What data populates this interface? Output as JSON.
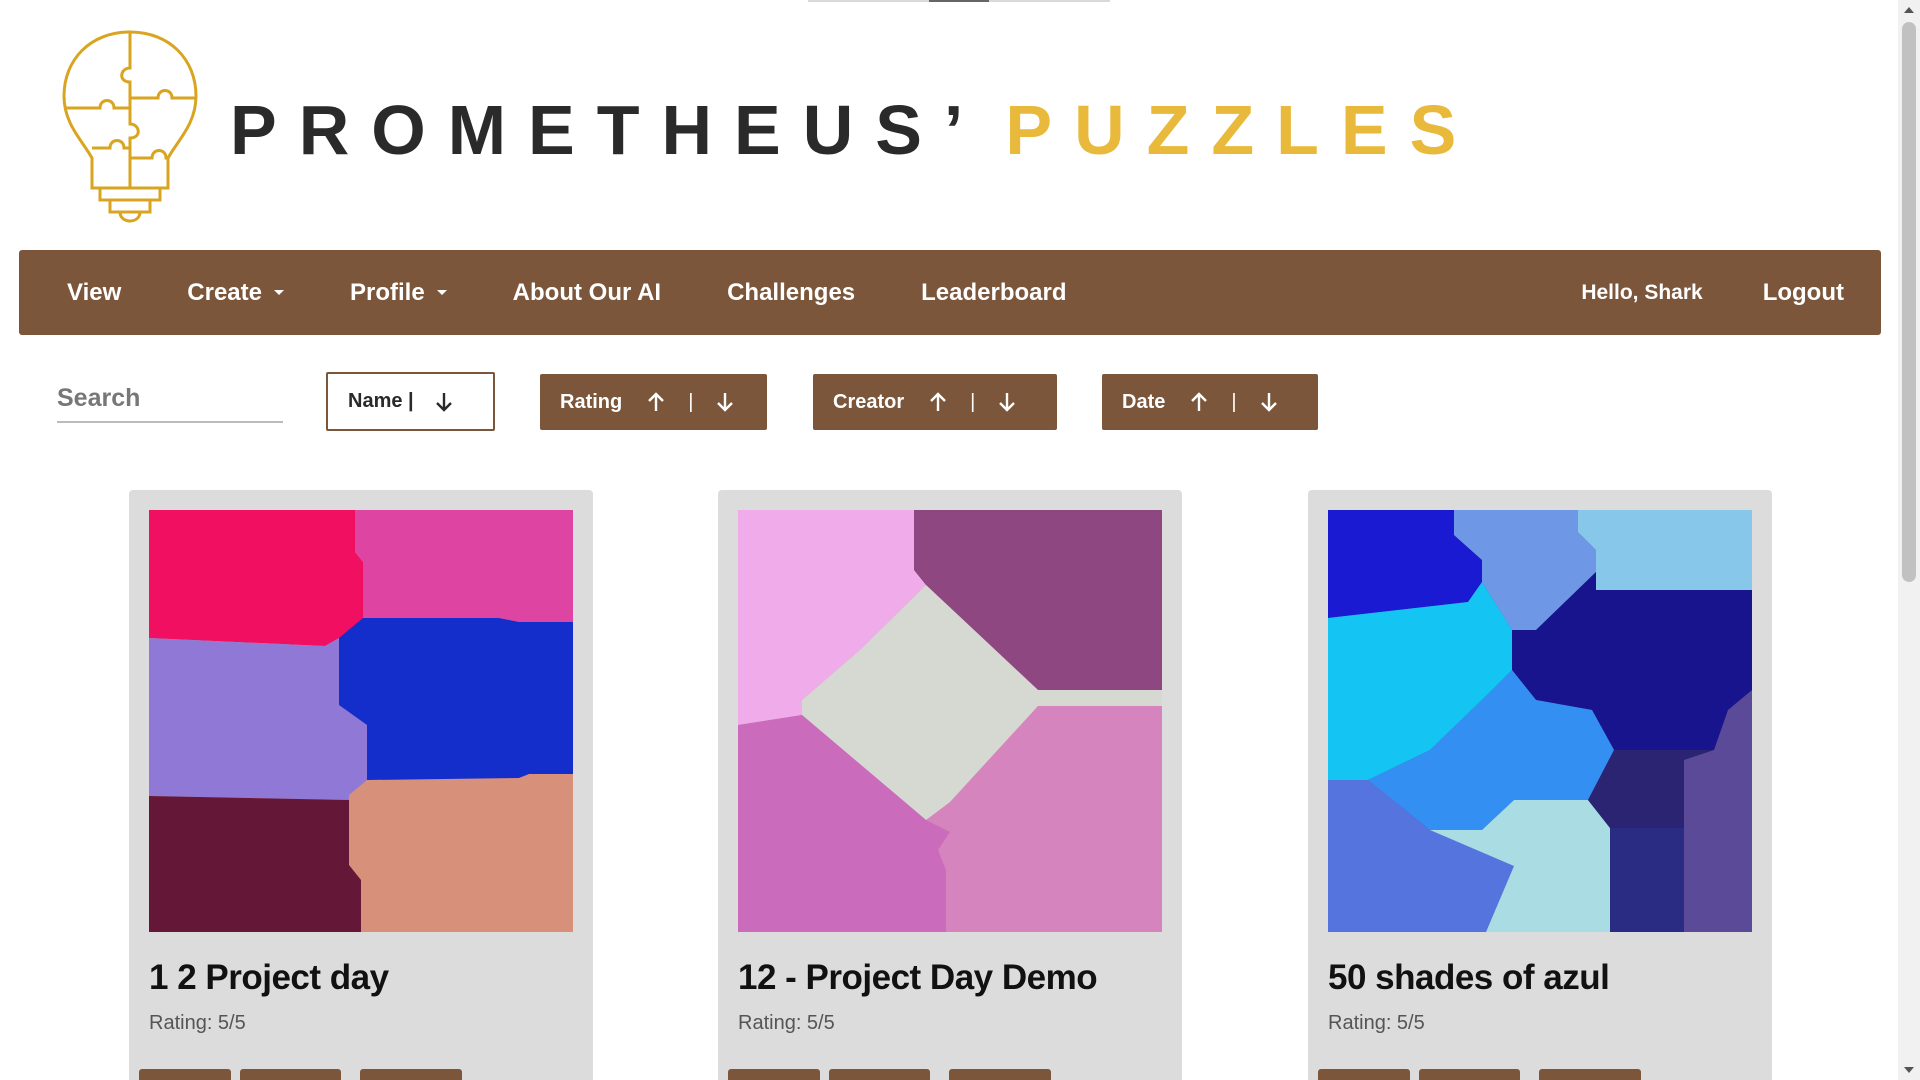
{
  "brand": {
    "word1": "PROMETHEUS’",
    "word2": "PUZZLES",
    "color_dark": "#2a2a2a",
    "color_gold": "#e8b93a"
  },
  "nav": {
    "items": [
      {
        "label": "View",
        "dropdown": false
      },
      {
        "label": "Create",
        "dropdown": true
      },
      {
        "label": "Profile",
        "dropdown": true
      },
      {
        "label": "About Our AI",
        "dropdown": false
      },
      {
        "label": "Challenges",
        "dropdown": false
      },
      {
        "label": "Leaderboard",
        "dropdown": false
      }
    ],
    "greeting": "Hello, Shark",
    "logout": "Logout",
    "color": "#7b563a"
  },
  "search": {
    "placeholder": "Search",
    "value": ""
  },
  "sort": {
    "name": "Name |",
    "rating": "Rating",
    "creator": "Creator",
    "date": "Date",
    "separator": "|"
  },
  "cards": [
    {
      "title": "1 2 Project day",
      "rating": "Rating: 5/5"
    },
    {
      "title": "12 - Project Day Demo",
      "rating": "Rating: 5/5"
    },
    {
      "title": "50 shades of azul",
      "rating": "Rating: 5/5"
    }
  ]
}
